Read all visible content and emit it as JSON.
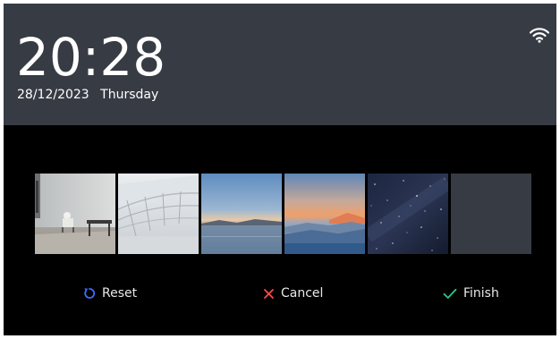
{
  "status": {
    "time": "20:28",
    "date": "28/12/2023",
    "weekday": "Thursday",
    "wifi_icon": "wifi-icon"
  },
  "wallpapers": [
    {
      "name": "room"
    },
    {
      "name": "architecture"
    },
    {
      "name": "lake-sunset"
    },
    {
      "name": "mountain-sunset"
    },
    {
      "name": "starry-sky"
    },
    {
      "name": "empty"
    }
  ],
  "actions": {
    "reset_label": "Reset",
    "cancel_label": "Cancel",
    "finish_label": "Finish"
  },
  "colors": {
    "header_bg": "#373b44",
    "reset_icon": "#3d6bff",
    "cancel_icon": "#ff4a4a",
    "finish_icon": "#27c98a"
  }
}
